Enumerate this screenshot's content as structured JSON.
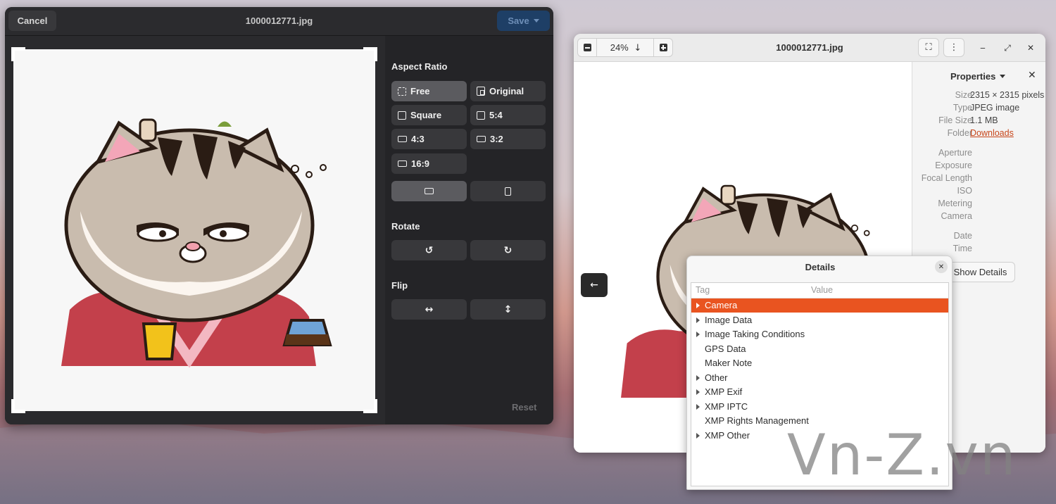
{
  "editor": {
    "cancel_label": "Cancel",
    "title": "1000012771.jpg",
    "save_label": "Save",
    "aspect_ratio_title": "Aspect Ratio",
    "aspect_options": [
      {
        "label": "Free",
        "icon": "dashed-square-icon",
        "selected": true
      },
      {
        "label": "Original",
        "icon": "original-image-icon"
      },
      {
        "label": "Square",
        "icon": "square-icon"
      },
      {
        "label": "5:4",
        "icon": "rect-icon"
      },
      {
        "label": "4:3",
        "icon": "rect-icon"
      },
      {
        "label": "3:2",
        "icon": "rect-icon"
      },
      {
        "label": "16:9",
        "icon": "rect-icon"
      }
    ],
    "orientation": [
      "landscape-icon",
      "portrait-icon"
    ],
    "rotate_title": "Rotate",
    "rotate_left_glyph": "↺",
    "rotate_right_glyph": "↻",
    "flip_title": "Flip",
    "flip_h_glyph": "↔",
    "flip_v_glyph": "↕",
    "reset_label": "Reset"
  },
  "viewer": {
    "zoom": "24%",
    "zoom_arrow": "↓",
    "title": "1000012771.jpg",
    "prev_glyph": "←",
    "next_glyph": "→",
    "properties_title": "Properties",
    "properties": [
      {
        "key": "Size",
        "value": "2315 × 2315 pixels"
      },
      {
        "key": "Type",
        "value": "JPEG image"
      },
      {
        "key": "File Size",
        "value": "1.1 MB"
      },
      {
        "key": "Folder",
        "value": "Downloads",
        "link": true
      },
      {
        "key": "Aperture",
        "value": ""
      },
      {
        "key": "Exposure",
        "value": ""
      },
      {
        "key": "Focal Length",
        "value": ""
      },
      {
        "key": "ISO",
        "value": ""
      },
      {
        "key": "Metering",
        "value": ""
      },
      {
        "key": "Camera",
        "value": ""
      },
      {
        "key": "Date",
        "value": ""
      },
      {
        "key": "Time",
        "value": ""
      }
    ],
    "show_details_label": "Show Details"
  },
  "details": {
    "title": "Details",
    "col_tag": "Tag",
    "col_value": "Value",
    "rows": [
      {
        "label": "Camera",
        "expandable": true,
        "selected": true
      },
      {
        "label": "Image Data",
        "expandable": true
      },
      {
        "label": "Image Taking Conditions",
        "expandable": true
      },
      {
        "label": "GPS Data",
        "expandable": false
      },
      {
        "label": "Maker Note",
        "expandable": false
      },
      {
        "label": "Other",
        "expandable": true
      },
      {
        "label": "XMP Exif",
        "expandable": true
      },
      {
        "label": "XMP IPTC",
        "expandable": true
      },
      {
        "label": "XMP Rights Management",
        "expandable": false
      },
      {
        "label": "XMP Other",
        "expandable": true
      }
    ]
  },
  "watermark": "Vn-Z.vn",
  "colors": {
    "accent": "#e95420",
    "link": "#c7451a",
    "save_disabled": "#1e3f66"
  }
}
